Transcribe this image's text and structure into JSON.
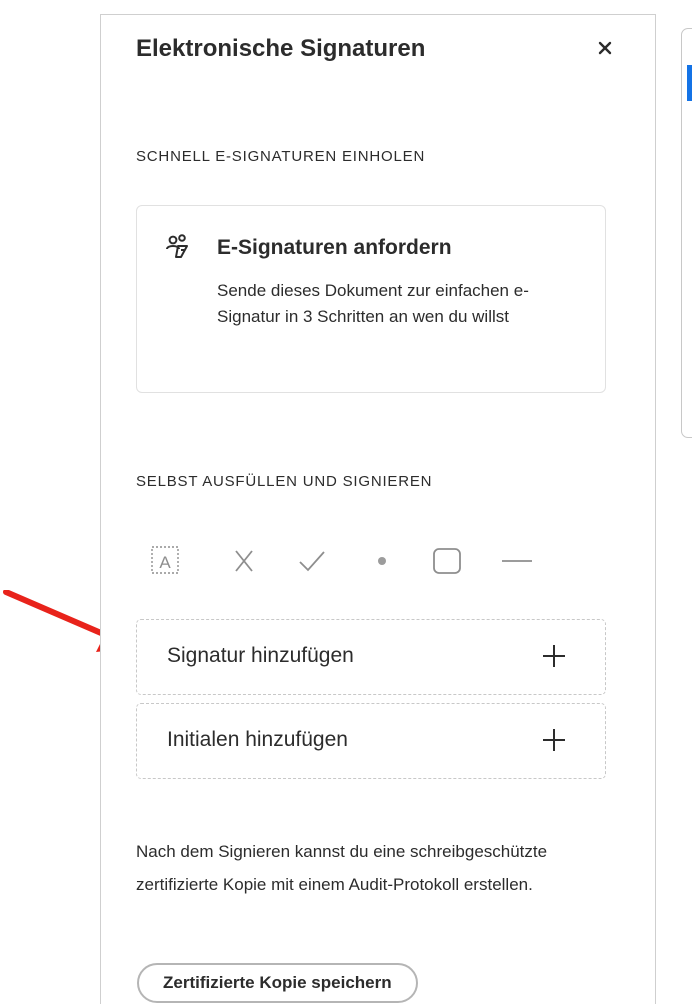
{
  "panel": {
    "title": "Elektronische Signaturen",
    "close_icon": "close-icon"
  },
  "quick_section": {
    "label": "SCHNELL E-SIGNATUREN EINHOLEN",
    "card": {
      "icon": "people-signature-icon",
      "title": "E-Signaturen anfordern",
      "description": "Sende dieses Dokument zur einfachen e-Signatur in 3 Schritten an wen du willst"
    }
  },
  "self_section": {
    "label": "SELBST AUSFÜLLEN UND SIGNIEREN",
    "tools": [
      {
        "name": "text-field-tool",
        "icon": "text-field-icon",
        "glyph": "A"
      },
      {
        "name": "cross-tool",
        "icon": "cross-mark-icon"
      },
      {
        "name": "check-tool",
        "icon": "checkmark-icon"
      },
      {
        "name": "dot-tool",
        "icon": "dot-icon"
      },
      {
        "name": "rectangle-tool",
        "icon": "rounded-rectangle-icon"
      },
      {
        "name": "line-tool",
        "icon": "line-icon"
      }
    ],
    "add_signature": "Signatur hinzufügen",
    "add_initials": "Initialen hinzufügen"
  },
  "note": "Nach dem Signieren kannst du eine schreibgeschützte zertifizierte Kopie mit einem Audit-Protokoll erstellen.",
  "save_button": "Zertifizierte Kopie speichern",
  "colors": {
    "text": "#2c2c2c",
    "icon_gray": "#8e8e8e",
    "accent_blue": "#1473e6",
    "annotation_red": "#e8231b"
  }
}
